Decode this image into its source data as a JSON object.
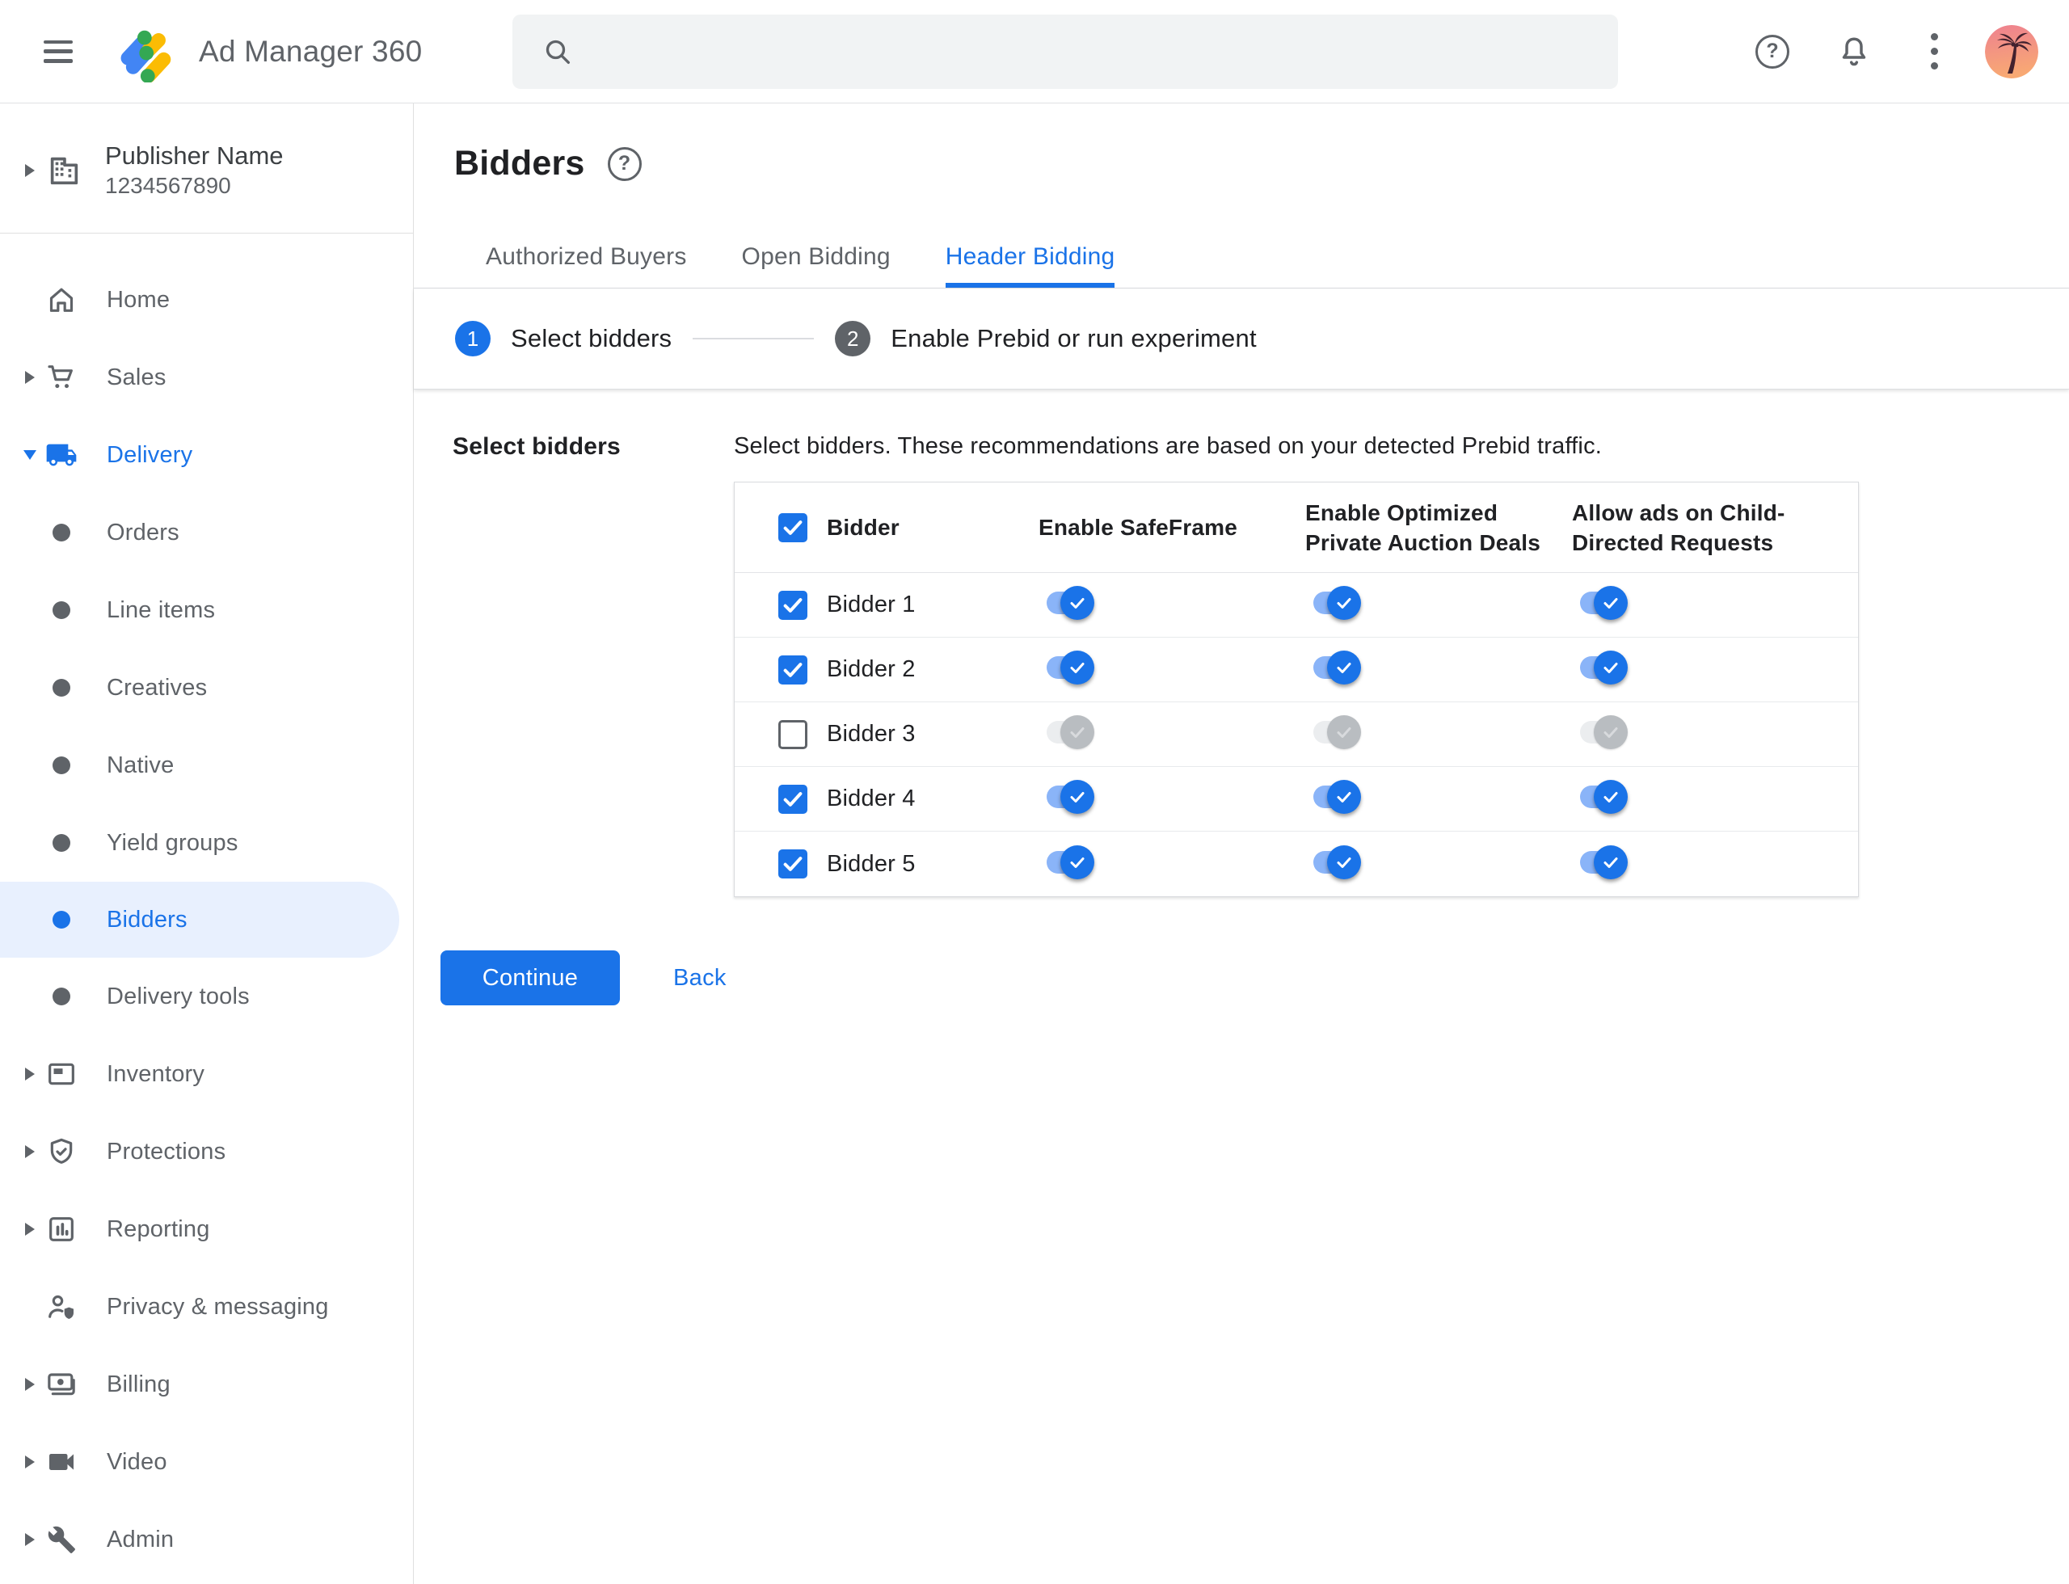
{
  "topbar": {
    "app_title": "Ad Manager 360",
    "search": {
      "placeholder": "",
      "value": ""
    }
  },
  "sidebar": {
    "publisher": {
      "name": "Publisher Name",
      "id": "1234567890"
    },
    "items": [
      {
        "label": "Home",
        "icon": "home-icon",
        "caret": "none",
        "level": "top"
      },
      {
        "label": "Sales",
        "icon": "cart-icon",
        "caret": "right",
        "level": "top"
      },
      {
        "label": "Delivery",
        "icon": "truck-icon",
        "caret": "down",
        "level": "top",
        "expanded": true,
        "highlighted": true
      },
      {
        "label": "Orders",
        "icon": "dot",
        "caret": "none",
        "level": "child"
      },
      {
        "label": "Line items",
        "icon": "dot",
        "caret": "none",
        "level": "child"
      },
      {
        "label": "Creatives",
        "icon": "dot",
        "caret": "none",
        "level": "child"
      },
      {
        "label": "Native",
        "icon": "dot",
        "caret": "none",
        "level": "child"
      },
      {
        "label": "Yield groups",
        "icon": "dot",
        "caret": "none",
        "level": "child"
      },
      {
        "label": "Bidders",
        "icon": "dot",
        "caret": "none",
        "level": "child",
        "selected": true
      },
      {
        "label": "Delivery tools",
        "icon": "dot",
        "caret": "none",
        "level": "child"
      },
      {
        "label": "Inventory",
        "icon": "inventory-icon",
        "caret": "right",
        "level": "top"
      },
      {
        "label": "Protections",
        "icon": "shield-icon",
        "caret": "right",
        "level": "top"
      },
      {
        "label": "Reporting",
        "icon": "report-icon",
        "caret": "right",
        "level": "top"
      },
      {
        "label": "Privacy & messaging",
        "icon": "privacy-icon",
        "caret": "none",
        "level": "top"
      },
      {
        "label": "Billing",
        "icon": "billing-icon",
        "caret": "right",
        "level": "top"
      },
      {
        "label": "Video",
        "icon": "video-icon",
        "caret": "right",
        "level": "top"
      },
      {
        "label": "Admin",
        "icon": "admin-icon",
        "caret": "right",
        "level": "top"
      }
    ]
  },
  "page": {
    "title": "Bidders"
  },
  "tabs": [
    {
      "label": "Authorized Buyers",
      "active": false
    },
    {
      "label": "Open Bidding",
      "active": false
    },
    {
      "label": "Header Bidding",
      "active": true
    }
  ],
  "stepper": [
    {
      "number": "1",
      "label": "Select bidders",
      "state": "active"
    },
    {
      "number": "2",
      "label": "Enable Prebid or run experiment",
      "state": "upcoming"
    }
  ],
  "content": {
    "section_label": "Select bidders",
    "description": "Select bidders. These recommendations are based on your detected Prebid traffic.",
    "table": {
      "header_checkbox_checked": true,
      "columns": [
        "Bidder",
        "Enable SafeFrame",
        "Enable Optimized Private Auction Deals",
        "Allow ads on Child-Directed Requests"
      ],
      "rows": [
        {
          "name": "Bidder 1",
          "checked": true,
          "enable_safeframe": true,
          "enable_optimized_private_auction_deals": true,
          "allow_ads_child_directed": true
        },
        {
          "name": "Bidder 2",
          "checked": true,
          "enable_safeframe": true,
          "enable_optimized_private_auction_deals": true,
          "allow_ads_child_directed": true
        },
        {
          "name": "Bidder 3",
          "checked": false,
          "enable_safeframe": false,
          "enable_optimized_private_auction_deals": false,
          "allow_ads_child_directed": false
        },
        {
          "name": "Bidder 4",
          "checked": true,
          "enable_safeframe": true,
          "enable_optimized_private_auction_deals": true,
          "allow_ads_child_directed": true
        },
        {
          "name": "Bidder 5",
          "checked": true,
          "enable_safeframe": true,
          "enable_optimized_private_auction_deals": true,
          "allow_ads_child_directed": true
        }
      ]
    },
    "continue_label": "Continue",
    "back_label": "Back"
  },
  "colors": {
    "accent_blue": "#1a73e8",
    "toggle_track_on": "#8ab4f8",
    "selected_pill": "#e8f0fe",
    "text_dark": "#202124",
    "text_gray": "#5f6368",
    "border": "#dadce0",
    "search_bg": "#f1f3f4"
  }
}
